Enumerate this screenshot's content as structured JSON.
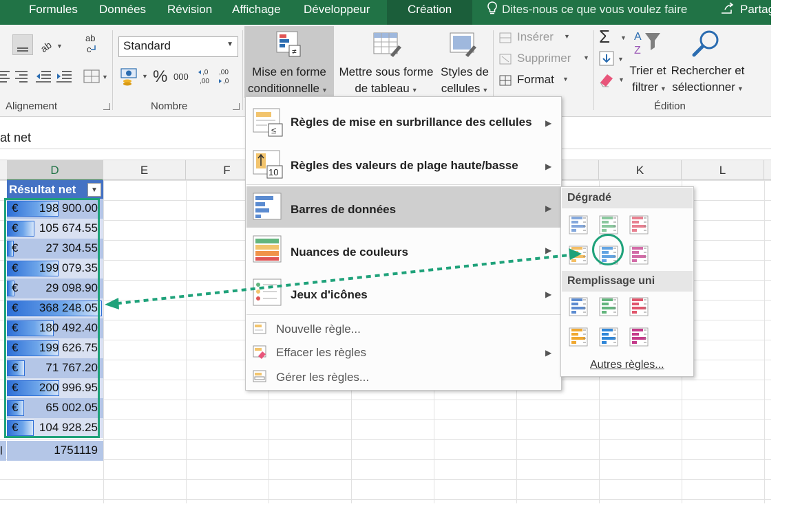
{
  "tabs": {
    "formulas": "Formules",
    "data": "Données",
    "review": "Révision",
    "view": "Affichage",
    "developer": "Développeur",
    "creation": "Création",
    "tell_me": "Dites-nous ce que vous voulez faire",
    "share": "Partag"
  },
  "ribbon": {
    "alignment_group": "Alignement",
    "number_group": "Nombre",
    "number_format": "Standard",
    "percent": "%",
    "thousands": "000",
    "cond_format": {
      "line1": "Mise en forme",
      "line2": "conditionnelle"
    },
    "format_table": {
      "line1": "Mettre sous forme",
      "line2": "de tableau"
    },
    "cell_styles": {
      "line1": "Styles de",
      "line2": "cellules"
    },
    "insert": "Insérer",
    "delete": "Supprimer",
    "format": "Format",
    "sort_filter": {
      "line1": "Trier et",
      "line2": "filtrer"
    },
    "find_select": {
      "line1": "Rechercher et",
      "line2": "sélectionner"
    },
    "editing_group": "Édition"
  },
  "formula_bar": {
    "content": "at net"
  },
  "columns": [
    "D",
    "E",
    "F",
    "K",
    "L"
  ],
  "table": {
    "header": "Résultat net",
    "currency": "€",
    "rows": [
      {
        "value": "198 900.00",
        "bar": 0.54
      },
      {
        "value": "105 674.55",
        "bar": 0.29
      },
      {
        "value": "27 304.55",
        "bar": 0.07
      },
      {
        "value": "199 079.35",
        "bar": 0.54
      },
      {
        "value": "29 098.90",
        "bar": 0.08
      },
      {
        "value": "368 248.05",
        "bar": 1.0
      },
      {
        "value": "180 492.40",
        "bar": 0.49
      },
      {
        "value": "199 626.75",
        "bar": 0.54
      },
      {
        "value": "71 767.20",
        "bar": 0.19
      },
      {
        "value": "200 996.95",
        "bar": 0.55
      },
      {
        "value": "65 002.05",
        "bar": 0.18
      },
      {
        "value": "104 928.25",
        "bar": 0.28
      }
    ],
    "total_label": "l",
    "total": "1751119"
  },
  "cf_menu": {
    "highlight_rules": "Règles de mise en surbrillance des cellules",
    "top_bottom": "Règles des valeurs de plage haute/basse",
    "top_bottom_icon_text": "10",
    "highlight_icon_text": "≤",
    "data_bars": "Barres de données",
    "color_scales": "Nuances de couleurs",
    "icon_sets": "Jeux d'icônes",
    "new_rule": "Nouvelle règle...",
    "clear_rules": "Effacer les règles",
    "manage_rules": "Gérer les règles..."
  },
  "data_bars_submenu": {
    "gradient": "Dégradé",
    "solid": "Remplissage uni",
    "more_rules": "Autres règles...",
    "swatch_colors": [
      "#5b8bd0",
      "#63b57d",
      "#e0556b",
      "#f0a830",
      "#2f86d8",
      "#c43a8a"
    ]
  },
  "colors": {
    "excel_green": "#217346",
    "accent_teal": "#1fa27a",
    "table_header": "#4472c4",
    "bar_blue": "#2e6fd6"
  }
}
